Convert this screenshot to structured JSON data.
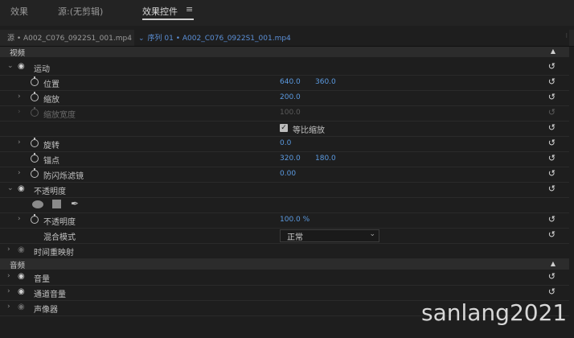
{
  "tabs": [
    {
      "label": "效果"
    },
    {
      "label": "源:(无剪辑)"
    },
    {
      "label": "效果控件"
    }
  ],
  "tab_menu_icon": "≡",
  "source_tab": {
    "label": "源 • A002_C076_0922S1_001.mp4"
  },
  "sequence_tab": {
    "label": "序列 01 • A002_C076_0922S1_001.mp4"
  },
  "sections": {
    "video": "视频",
    "audio": "音频"
  },
  "rows": {
    "motion": {
      "label": "运动"
    },
    "position": {
      "label": "位置",
      "x": "640.0",
      "y": "360.0"
    },
    "scale": {
      "label": "缩放",
      "value": "200.0"
    },
    "scale_width": {
      "label": "缩放宽度",
      "value": "100.0"
    },
    "uniform_scale": {
      "label": "等比缩放",
      "checked": true
    },
    "rotation": {
      "label": "旋转",
      "value": "0.0"
    },
    "anchor": {
      "label": "锚点",
      "x": "320.0",
      "y": "180.0"
    },
    "anti_flicker": {
      "label": "防闪烁滤镜",
      "value": "0.00"
    },
    "opacity_group": {
      "label": "不透明度"
    },
    "opacity": {
      "label": "不透明度",
      "value": "100.0 %"
    },
    "blend_mode": {
      "label": "混合模式",
      "value": "正常"
    },
    "time_remap": {
      "label": "时间重映射"
    },
    "volume": {
      "label": "音量"
    },
    "channel_volume": {
      "label": "通道音量"
    },
    "panner": {
      "label": "声像器"
    }
  },
  "watermark": "sanlang2021",
  "icons": {
    "reset": "reset-icon",
    "stopwatch": "stopwatch-icon",
    "eye": "eye-icon",
    "chevron": "chevron-right-icon",
    "up": "triangle-up-icon"
  },
  "colors": {
    "value_blue": "#5b9ae0",
    "link_blue": "#5b8fd6",
    "background": "#1e1e1e"
  }
}
